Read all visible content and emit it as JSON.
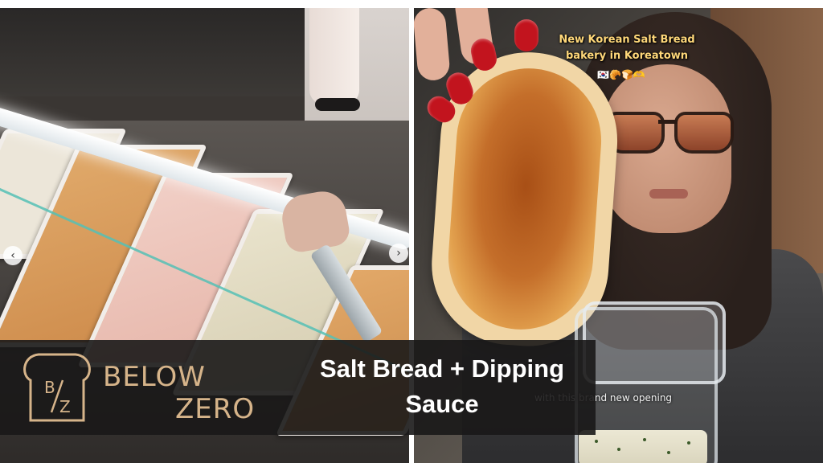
{
  "banner": {
    "headline": "Salt Bread + Dipping Sauce",
    "logo": {
      "monogram": "B/Z",
      "brand_line1": "BELOW",
      "brand_line2": "ZERO",
      "color": "#d6b48a"
    },
    "background_color": "#1a1818"
  },
  "left_photo": {
    "carousel_prev_icon": "chevron-left-icon",
    "carousel_next_icon": "chevron-right-icon",
    "carousel_prev_glyph": "‹",
    "carousel_next_glyph": "›"
  },
  "right_photo": {
    "overlay_caption_line1": "New Korean Salt Bread",
    "overlay_caption_line2": "bakery in Koreatown",
    "overlay_emoji": "🇰🇷🥐🍞🫶",
    "overlay_subtitle": "with this brand new opening"
  }
}
